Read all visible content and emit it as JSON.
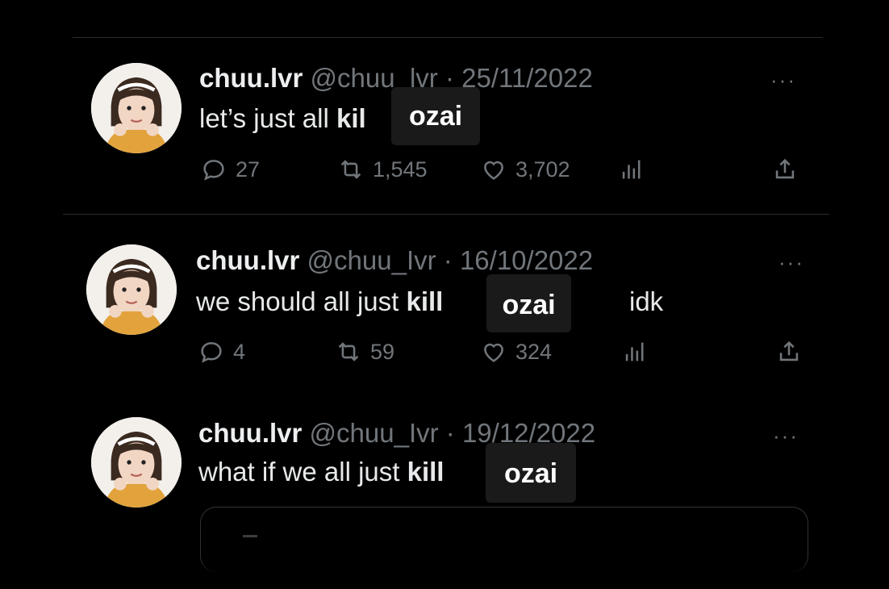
{
  "tweets": [
    {
      "name": "chuu.lvr",
      "handle": "@chuu_lvr",
      "separator": "·",
      "date": "25/11/2022",
      "text_plain": "let’s just all ",
      "text_bold": "kil",
      "text_after": "",
      "redaction": "ozai",
      "more": "···",
      "replies": "27",
      "retweets": "1,545",
      "likes": "3,702"
    },
    {
      "name": "chuu.lvr",
      "handle": "@chuu_Ivr",
      "separator": "·",
      "date": "16/10/2022",
      "text_plain": "we should all just ",
      "text_bold": "kill",
      "text_after": "idk",
      "redaction": "ozai",
      "more": "···",
      "replies": "4",
      "retweets": "59",
      "likes": "324"
    },
    {
      "name": "chuu.lvr",
      "handle": "@chuu_Ivr",
      "separator": "·",
      "date": "19/12/2022",
      "text_plain": "what if we all just ",
      "text_bold": "kill",
      "text_after": "",
      "redaction": "ozai",
      "more": "···"
    }
  ],
  "icons": [
    "reply-icon",
    "retweet-icon",
    "like-icon",
    "views-icon",
    "share-icon",
    "more-icon"
  ],
  "colors": {
    "background": "#000000",
    "muted": "#71767b",
    "text": "#e7e9ea",
    "redaction_box": "#1a1a1a"
  }
}
